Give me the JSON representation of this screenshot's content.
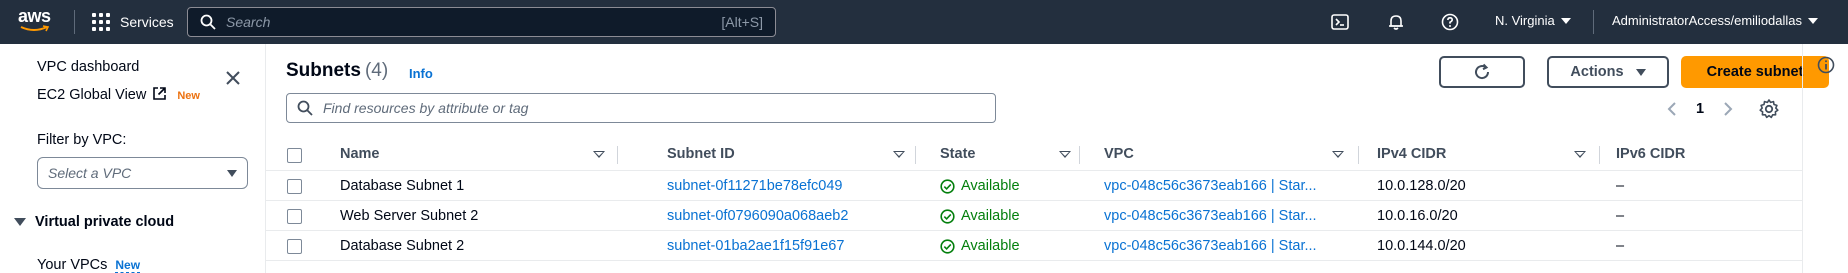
{
  "nav": {
    "logo_text": "aws",
    "services_label": "Services",
    "search_placeholder": "Search",
    "search_shortcut": "[Alt+S]",
    "region": "N. Virginia",
    "account": "AdministratorAccess/emiliodallas"
  },
  "sidebar": {
    "dashboard": "VPC dashboard",
    "global_view": "EC2 Global View",
    "global_view_badge": "New",
    "filter_label": "Filter by VPC:",
    "filter_placeholder": "Select a VPC",
    "section_title": "Virtual private cloud",
    "your_vpcs": "Your VPCs",
    "your_vpcs_badge": "New"
  },
  "main": {
    "title": "Subnets",
    "count": "(4)",
    "info": "Info",
    "actions_label": "Actions",
    "create_label": "Create subnet",
    "filter_placeholder": "Find resources by attribute or tag",
    "page": "1"
  },
  "table": {
    "columns": [
      "Name",
      "Subnet ID",
      "State",
      "VPC",
      "IPv4 CIDR",
      "IPv6 CIDR"
    ],
    "rows": [
      {
        "name": "Database Subnet 1",
        "subnet_id": "subnet-0f11271be78efc049",
        "state": "Available",
        "vpc": "vpc-048c56c3673eab166 | Star...",
        "ipv4": "10.0.128.0/20",
        "ipv6": "–"
      },
      {
        "name": "Web Server Subnet 2",
        "subnet_id": "subnet-0f0796090a068aeb2",
        "state": "Available",
        "vpc": "vpc-048c56c3673eab166 | Star...",
        "ipv4": "10.0.16.0/20",
        "ipv6": "–"
      },
      {
        "name": "Database Subnet 2",
        "subnet_id": "subnet-01ba2ae1f15f91e67",
        "state": "Available",
        "vpc": "vpc-048c56c3673eab166 | Star...",
        "ipv4": "10.0.144.0/20",
        "ipv6": "–"
      }
    ]
  },
  "colors": {
    "nav_bg": "#232f3e",
    "primary_button": "#ff9900",
    "link": "#0972d3",
    "success": "#037f0c",
    "new_badge": "#ec7211"
  }
}
